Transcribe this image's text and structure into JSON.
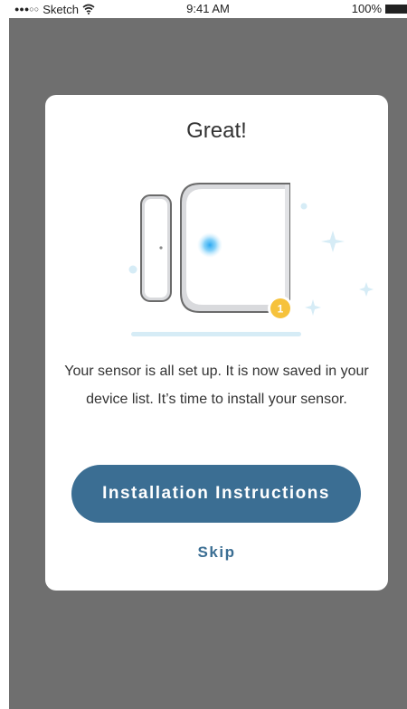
{
  "status_bar": {
    "carrier": "Sketch",
    "time": "9:41 AM",
    "battery": "100%"
  },
  "modal": {
    "title": "Great!",
    "body": "Your sensor is all set up. It is now saved in your device list. It’s time to install your sensor.",
    "primary_button_label": "Installation Instructions",
    "secondary_link_label": "Skip",
    "badge_number": "1"
  },
  "colors": {
    "overlay": "#6f6f6f",
    "accent": "#3b6e93",
    "badge": "#f6c23b",
    "sensor_light": "#2aa8f2"
  },
  "icons": [
    "wifi-icon",
    "battery-icon",
    "signal-dots-icon",
    "door-sensor-illustration",
    "sparkle-icon"
  ]
}
